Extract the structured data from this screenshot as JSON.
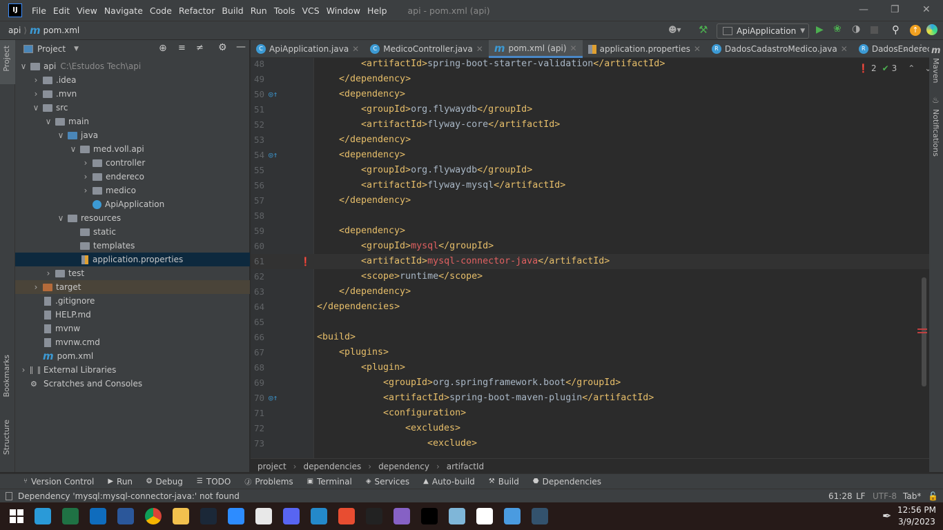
{
  "window": {
    "title": "api - pom.xml (api)",
    "logo": "IJ"
  },
  "menu": [
    "File",
    "Edit",
    "View",
    "Navigate",
    "Code",
    "Refactor",
    "Build",
    "Run",
    "Tools",
    "VCS",
    "Window",
    "Help"
  ],
  "nav": {
    "crumbs": [
      "api",
      "pom.xml"
    ],
    "run_config": "ApiApplication"
  },
  "sidebar_tabs": {
    "project": "Project",
    "bookmarks": "Bookmarks",
    "structure": "Structure",
    "maven": "Maven",
    "notifications": "Notifications"
  },
  "project": {
    "title": "Project",
    "tree": [
      {
        "label": "api",
        "path": "C:\\Estudos Tech\\api",
        "level": 0,
        "arrow": "open",
        "icon": "folder"
      },
      {
        "label": ".idea",
        "level": 1,
        "arrow": "closed",
        "icon": "folder"
      },
      {
        "label": ".mvn",
        "level": 1,
        "arrow": "closed",
        "icon": "folder"
      },
      {
        "label": "src",
        "level": 1,
        "arrow": "open",
        "icon": "folder"
      },
      {
        "label": "main",
        "level": 2,
        "arrow": "open",
        "icon": "folder"
      },
      {
        "label": "java",
        "level": 3,
        "arrow": "open",
        "icon": "folder-blue"
      },
      {
        "label": "med.voll.api",
        "level": 4,
        "arrow": "open",
        "icon": "package"
      },
      {
        "label": "controller",
        "level": 5,
        "arrow": "closed",
        "icon": "package"
      },
      {
        "label": "endereco",
        "level": 5,
        "arrow": "closed",
        "icon": "package"
      },
      {
        "label": "medico",
        "level": 5,
        "arrow": "closed",
        "icon": "package"
      },
      {
        "label": "ApiApplication",
        "level": 5,
        "arrow": "none",
        "icon": "class"
      },
      {
        "label": "resources",
        "level": 3,
        "arrow": "open",
        "icon": "folder"
      },
      {
        "label": "static",
        "level": 4,
        "arrow": "none",
        "icon": "folder"
      },
      {
        "label": "templates",
        "level": 4,
        "arrow": "none",
        "icon": "folder"
      },
      {
        "label": "application.properties",
        "level": 4,
        "arrow": "none",
        "icon": "properties",
        "selected": true
      },
      {
        "label": "test",
        "level": 2,
        "arrow": "closed",
        "icon": "folder"
      },
      {
        "label": "target",
        "level": 1,
        "arrow": "closed",
        "icon": "folder-orange",
        "highlight": true
      },
      {
        "label": ".gitignore",
        "level": 1,
        "arrow": "none",
        "icon": "file"
      },
      {
        "label": "HELP.md",
        "level": 1,
        "arrow": "none",
        "icon": "file"
      },
      {
        "label": "mvnw",
        "level": 1,
        "arrow": "none",
        "icon": "file"
      },
      {
        "label": "mvnw.cmd",
        "level": 1,
        "arrow": "none",
        "icon": "file"
      },
      {
        "label": "pom.xml",
        "level": 1,
        "arrow": "none",
        "icon": "maven"
      },
      {
        "label": "External Libraries",
        "level": 0,
        "arrow": "closed",
        "icon": "libraries"
      },
      {
        "label": "Scratches and Consoles",
        "level": 0,
        "arrow": "none",
        "icon": "scratches"
      }
    ]
  },
  "tabs": [
    {
      "label": "ApiApplication.java",
      "icon": "C",
      "active": false
    },
    {
      "label": "MedicoController.java",
      "icon": "C",
      "active": false
    },
    {
      "label": "pom.xml (api)",
      "icon": "m",
      "active": true
    },
    {
      "label": "application.properties",
      "icon": "props",
      "active": false
    },
    {
      "label": "DadosCadastroMedico.java",
      "icon": "R",
      "active": false
    },
    {
      "label": "DadosEndereco.ja",
      "icon": "R",
      "active": false
    }
  ],
  "inspections": {
    "errors": "2",
    "warnings": "3"
  },
  "code": [
    {
      "n": "47",
      "i": 12,
      "p": [
        [
          "tag",
          "<groupId>"
        ],
        [
          "val",
          "org.springframework.boot"
        ],
        [
          "tag",
          "</groupId>"
        ]
      ]
    },
    {
      "n": "48",
      "i": 12,
      "p": [
        [
          "tag",
          "<artifactId>"
        ],
        [
          "val",
          "spring-boot-starter-validation"
        ],
        [
          "tag",
          "</artifactId>"
        ]
      ]
    },
    {
      "n": "49",
      "i": 8,
      "p": [
        [
          "tag",
          "</dependency>"
        ]
      ]
    },
    {
      "n": "50",
      "i": 8,
      "p": [
        [
          "tag",
          "<dependency>"
        ]
      ],
      "mark": "override"
    },
    {
      "n": "51",
      "i": 12,
      "p": [
        [
          "tag",
          "<groupId>"
        ],
        [
          "val",
          "org.flywaydb"
        ],
        [
          "tag",
          "</groupId>"
        ]
      ]
    },
    {
      "n": "52",
      "i": 12,
      "p": [
        [
          "tag",
          "<artifactId>"
        ],
        [
          "val",
          "flyway-core"
        ],
        [
          "tag",
          "</artifactId>"
        ]
      ]
    },
    {
      "n": "53",
      "i": 8,
      "p": [
        [
          "tag",
          "</dependency>"
        ]
      ]
    },
    {
      "n": "54",
      "i": 8,
      "p": [
        [
          "tag",
          "<dependency>"
        ]
      ],
      "mark": "override"
    },
    {
      "n": "55",
      "i": 12,
      "p": [
        [
          "tag",
          "<groupId>"
        ],
        [
          "val",
          "org.flywaydb"
        ],
        [
          "tag",
          "</groupId>"
        ]
      ]
    },
    {
      "n": "56",
      "i": 12,
      "p": [
        [
          "tag",
          "<artifactId>"
        ],
        [
          "val",
          "flyway-mysql"
        ],
        [
          "tag",
          "</artifactId>"
        ]
      ]
    },
    {
      "n": "57",
      "i": 8,
      "p": [
        [
          "tag",
          "</dependency>"
        ]
      ]
    },
    {
      "n": "58",
      "i": 0,
      "p": []
    },
    {
      "n": "59",
      "i": 8,
      "p": [
        [
          "tag",
          "<dependency>"
        ]
      ]
    },
    {
      "n": "60",
      "i": 12,
      "p": [
        [
          "tag",
          "<groupId>"
        ],
        [
          "err",
          "mysql"
        ],
        [
          "tag",
          "</groupId>"
        ]
      ]
    },
    {
      "n": "61",
      "i": 12,
      "p": [
        [
          "tag",
          "<artifactId>"
        ],
        [
          "err",
          "mysql-connector-java"
        ],
        [
          "tag",
          "</artifactId>"
        ]
      ],
      "current": true,
      "mark": "error"
    },
    {
      "n": "62",
      "i": 12,
      "p": [
        [
          "tag",
          "<scope>"
        ],
        [
          "val",
          "runtime"
        ],
        [
          "tag",
          "</scope>"
        ]
      ]
    },
    {
      "n": "63",
      "i": 8,
      "p": [
        [
          "tag",
          "</dependency>"
        ]
      ]
    },
    {
      "n": "64",
      "i": 4,
      "p": [
        [
          "tag",
          "</dependencies>"
        ]
      ]
    },
    {
      "n": "65",
      "i": 0,
      "p": []
    },
    {
      "n": "66",
      "i": 4,
      "p": [
        [
          "tag",
          "<build>"
        ]
      ]
    },
    {
      "n": "67",
      "i": 8,
      "p": [
        [
          "tag",
          "<plugins>"
        ]
      ]
    },
    {
      "n": "68",
      "i": 12,
      "p": [
        [
          "tag",
          "<plugin>"
        ]
      ]
    },
    {
      "n": "69",
      "i": 16,
      "p": [
        [
          "tag",
          "<groupId>"
        ],
        [
          "val",
          "org.springframework.boot"
        ],
        [
          "tag",
          "</groupId>"
        ]
      ]
    },
    {
      "n": "70",
      "i": 16,
      "p": [
        [
          "tag",
          "<artifactId>"
        ],
        [
          "val",
          "spring-boot-maven-plugin"
        ],
        [
          "tag",
          "</artifactId>"
        ]
      ],
      "mark": "override"
    },
    {
      "n": "71",
      "i": 16,
      "p": [
        [
          "tag",
          "<configuration>"
        ]
      ]
    },
    {
      "n": "72",
      "i": 20,
      "p": [
        [
          "tag",
          "<excludes>"
        ]
      ]
    },
    {
      "n": "73",
      "i": 24,
      "p": [
        [
          "tag",
          "<exclude>"
        ]
      ]
    }
  ],
  "breadcrumb": [
    "project",
    "dependencies",
    "dependency",
    "artifactId"
  ],
  "bottom_tools": [
    "Version Control",
    "Run",
    "Debug",
    "TODO",
    "Problems",
    "Terminal",
    "Services",
    "Auto-build",
    "Build",
    "Dependencies"
  ],
  "status": {
    "message": "Dependency 'mysql:mysql-connector-java:' not found",
    "position": "61:28",
    "line_sep": "LF",
    "encoding": "UTF-8",
    "indent": "Tab*"
  },
  "taskbar": {
    "apps": [
      "windows-start",
      "edge",
      "excel",
      "outlook",
      "word",
      "chrome",
      "file-explorer",
      "steam",
      "zoom",
      "paint",
      "discord",
      "vscode",
      "git",
      "epic-games",
      "visual-studio",
      "intellij",
      "notepad",
      "eclipse",
      "control-panel",
      "mysql-workbench"
    ],
    "colors": [
      "#ffffff",
      "#2a9ad8",
      "#1f7244",
      "#0f6cbd",
      "#2b579a",
      "#e3b341",
      "#f2c14e",
      "#1b2838",
      "#2d8cff",
      "#e8e8e8",
      "#5865f2",
      "#2489ca",
      "#e84d31",
      "#222222",
      "#8661c5",
      "#000000",
      "#7fb6d8",
      "#ffffff",
      "#4a9be0",
      "#33526d"
    ],
    "time": "12:56 PM",
    "date": "3/9/2023"
  }
}
